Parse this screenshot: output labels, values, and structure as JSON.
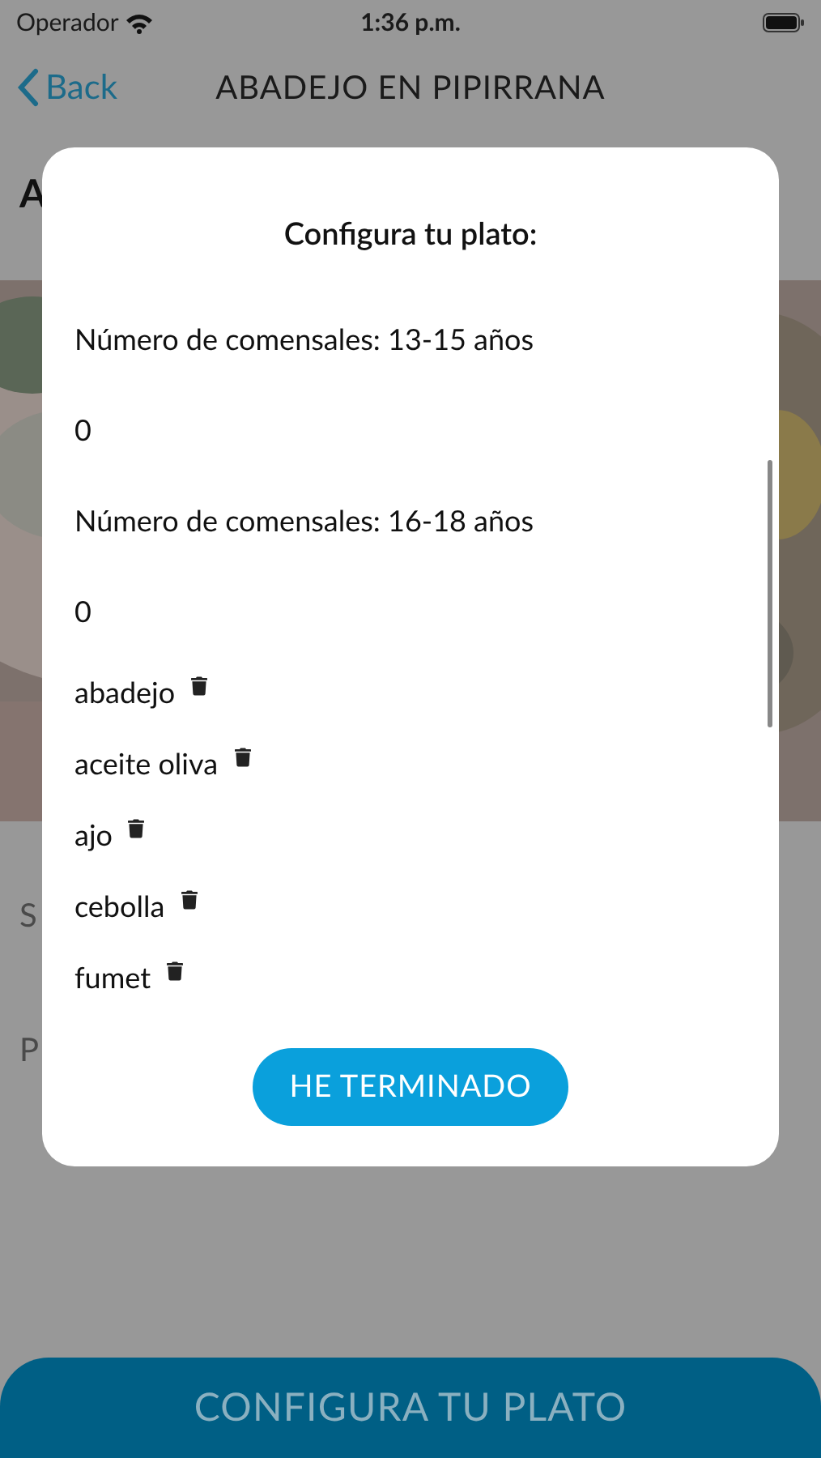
{
  "status_bar": {
    "carrier": "Operador",
    "time": "1:36 p.m."
  },
  "nav": {
    "back": "Back",
    "title": "ABADEJO EN PIPIRRANA"
  },
  "background": {
    "heading_peek": "A",
    "label_1_peek": "S",
    "label_2_peek": "P",
    "bottom_button": "CONFIGURA TU PLATO"
  },
  "modal": {
    "title": "Configura tu plato:",
    "items": [
      {
        "kind": "label",
        "text": "Número de comensales: 13-15 años"
      },
      {
        "kind": "value",
        "text": "0"
      },
      {
        "kind": "label",
        "text": "Número de comensales: 16-18 años"
      },
      {
        "kind": "value",
        "text": "0"
      },
      {
        "kind": "ingredient",
        "text": "abadejo"
      },
      {
        "kind": "ingredient",
        "text": "aceite oliva"
      },
      {
        "kind": "ingredient",
        "text": "ajo"
      },
      {
        "kind": "ingredient",
        "text": "cebolla"
      },
      {
        "kind": "ingredient",
        "text": "fumet"
      }
    ],
    "done_button": "HE TERMINADO"
  }
}
